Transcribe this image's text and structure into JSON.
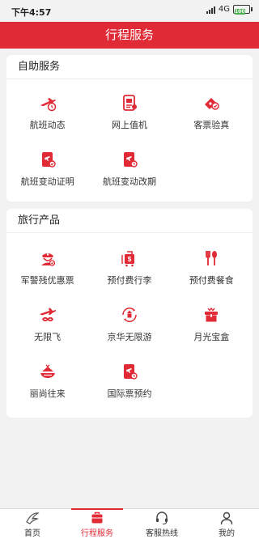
{
  "status_bar": {
    "time": "下午4:57",
    "network": "4G",
    "battery": "100"
  },
  "header": {
    "title": "行程服务"
  },
  "self_service": {
    "title": "自助服务",
    "items": [
      {
        "label": "航班动态",
        "icon": "flight-clock-icon"
      },
      {
        "label": "网上值机",
        "icon": "boarding-pass-icon"
      },
      {
        "label": "客票验真",
        "icon": "ticket-verify-icon"
      },
      {
        "label": "航班变动证明",
        "icon": "flight-change-certificate-icon"
      },
      {
        "label": "航班变动改期",
        "icon": "flight-reschedule-icon"
      }
    ]
  },
  "travel_products": {
    "title": "旅行产品",
    "items": [
      {
        "label": "军警残优惠票",
        "icon": "military-police-icon"
      },
      {
        "label": "预付费行李",
        "icon": "luggage-icon"
      },
      {
        "label": "预付费餐食",
        "icon": "meal-icon"
      },
      {
        "label": "无限飞",
        "icon": "unlimited-flight-icon"
      },
      {
        "label": "京华无限游",
        "icon": "travel-landmark-icon"
      },
      {
        "label": "月光宝盒",
        "icon": "treasure-box-icon"
      },
      {
        "label": "丽尚往来",
        "icon": "lishang-icon"
      },
      {
        "label": "国际票预约",
        "icon": "international-ticket-icon"
      }
    ]
  },
  "tabbar": {
    "tabs": [
      {
        "label": "首页",
        "icon": "home-icon"
      },
      {
        "label": "行程服务",
        "icon": "briefcase-icon"
      },
      {
        "label": "客服热线",
        "icon": "headset-icon"
      },
      {
        "label": "我的",
        "icon": "user-icon"
      }
    ]
  },
  "colors": {
    "brand": "#e02a35",
    "background": "#f2f2f2"
  }
}
